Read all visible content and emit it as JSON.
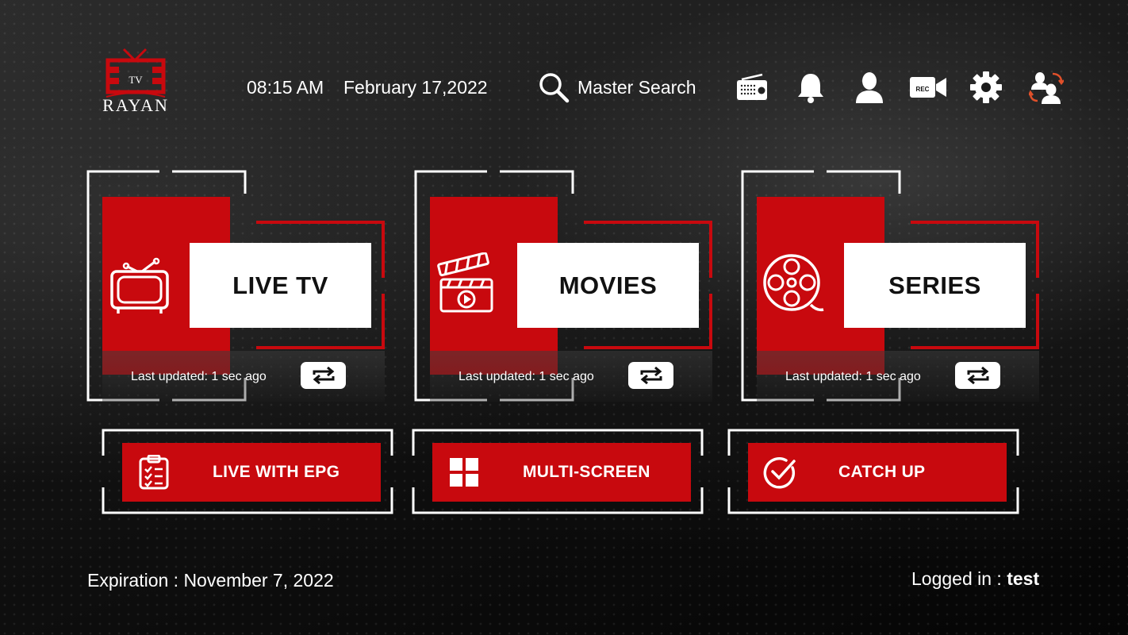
{
  "app": {
    "logo_text": "RAYAN",
    "logo_badge": "TV"
  },
  "header": {
    "time": "08:15 AM",
    "date": "February 17,2022",
    "search_label": "Master Search"
  },
  "header_icons": [
    "radio-icon",
    "bell-icon",
    "profile-icon",
    "recording-icon",
    "gear-icon",
    "switch-user-icon"
  ],
  "recording_badge": "REC",
  "cards": [
    {
      "title": "LIVE TV",
      "updated": "Last updated: 1 sec ago",
      "icon": "tv-icon"
    },
    {
      "title": "MOVIES",
      "updated": "Last updated: 1 sec ago",
      "icon": "clapperboard-icon"
    },
    {
      "title": "SERIES",
      "updated": "Last updated: 1 sec ago",
      "icon": "film-reel-icon"
    }
  ],
  "buttons": [
    {
      "label": "LIVE WITH EPG",
      "icon": "checklist-icon"
    },
    {
      "label": "MULTI-SCREEN",
      "icon": "grid-icon"
    },
    {
      "label": "CATCH UP",
      "icon": "check-circle-icon"
    }
  ],
  "footer": {
    "expiration": "Expiration : November 7, 2022",
    "logged_in_label": "Logged in : ",
    "username": "test"
  },
  "colors": {
    "accent": "#c8090e",
    "text": "#ffffff",
    "background": "#0a0a0a"
  }
}
